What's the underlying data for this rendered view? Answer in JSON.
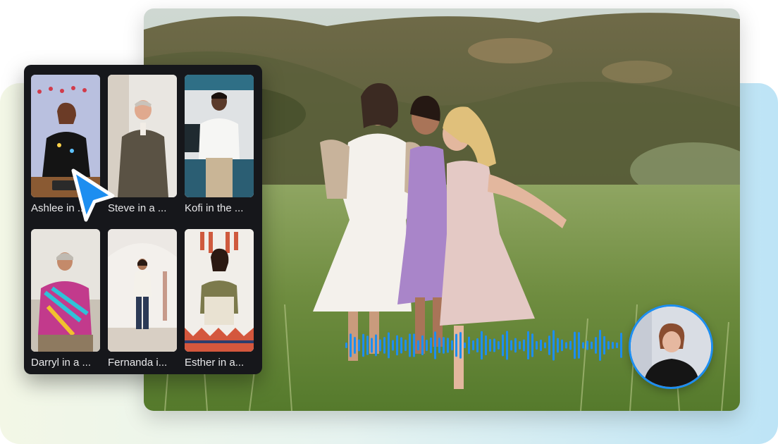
{
  "avatar_cards": [
    {
      "label": "Ashlee in ..."
    },
    {
      "label": "Steve in a ..."
    },
    {
      "label": "Kofi in the ..."
    },
    {
      "label": "Darryl in a ..."
    },
    {
      "label": "Fernanda i..."
    },
    {
      "label": "Esther in a..."
    }
  ],
  "colors": {
    "accent": "#1d8ef0",
    "panel_bg": "#16171b",
    "waveform": "#1d8ef0"
  },
  "icons": {
    "cursor": "pointer-arrow-icon",
    "waveform": "audio-waveform-icon"
  }
}
